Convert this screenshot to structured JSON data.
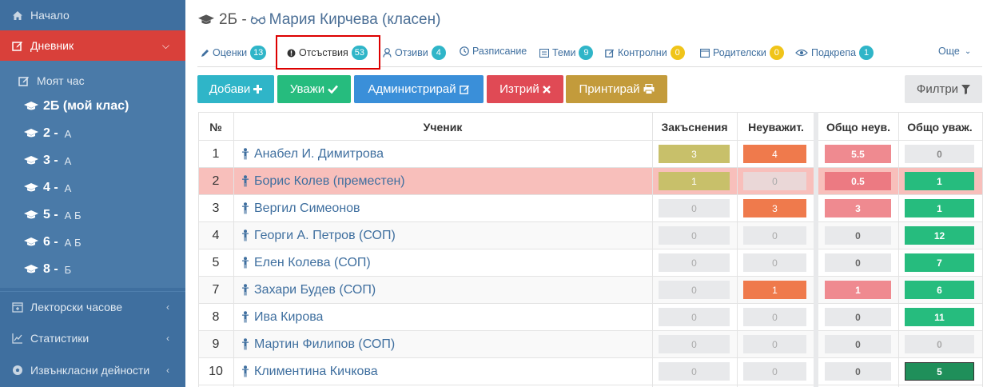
{
  "sidebar": {
    "items": [
      {
        "label": "Начало",
        "icon": "home-icon"
      },
      {
        "label": "Дневник",
        "icon": "edit-icon"
      },
      {
        "label": "Моят час",
        "icon": "edit-icon"
      },
      {
        "label": "2Б (мой клас)",
        "icon": "graduation-cap-icon"
      },
      {
        "label": "2 -",
        "suffix": "А",
        "icon": "graduation-cap-icon"
      },
      {
        "label": "3 -",
        "suffix": "А",
        "icon": "graduation-cap-icon"
      },
      {
        "label": "4 -",
        "suffix": "А",
        "icon": "graduation-cap-icon"
      },
      {
        "label": "5 -",
        "suffix": "А Б",
        "icon": "graduation-cap-icon"
      },
      {
        "label": "6 -",
        "suffix": "А Б",
        "icon": "graduation-cap-icon"
      },
      {
        "label": "8 -",
        "suffix": "Б",
        "icon": "graduation-cap-icon"
      },
      {
        "label": "Лекторски часове",
        "icon": "calendar-plus-icon"
      },
      {
        "label": "Статистики",
        "icon": "line-chart-icon"
      },
      {
        "label": "Извънкласни дейности",
        "icon": "soccer-ball-icon"
      }
    ]
  },
  "header": {
    "class_name": "2Б -",
    "teacher": "Мария Кирчева (класен)"
  },
  "tabs": [
    {
      "label": "Оценки",
      "badge": "13",
      "icon": "pencil-icon"
    },
    {
      "label": "Отсъствия",
      "badge": "53",
      "icon": "alert-circle-icon"
    },
    {
      "label": "Отзиви",
      "badge": "4",
      "icon": "user-icon"
    },
    {
      "label": "Разписание",
      "badge": "",
      "icon": "clock-icon"
    },
    {
      "label": "Теми",
      "badge": "9",
      "icon": "list-icon"
    },
    {
      "label": "Контролни",
      "badge": "0",
      "icon": "edit-icon"
    },
    {
      "label": "Родителски",
      "badge": "0",
      "icon": "calendar-icon"
    },
    {
      "label": "Подкрепа",
      "badge": "1",
      "icon": "eye-icon"
    }
  ],
  "more_label": "Още",
  "toolbar": {
    "add": "Добави",
    "excuse": "Уважи",
    "administer": "Администрирай",
    "delete": "Изтрий",
    "print": "Принтирай",
    "filters": "Филтри"
  },
  "colors": {
    "teal": "#2fb5c8",
    "green": "#26bc7e",
    "blue": "#3a8fd9",
    "red": "#e04a55",
    "olive": "#c39b3b",
    "orange": "#ef7a4c",
    "pink": "#ef8a90",
    "khaki": "#c8c06a"
  },
  "table": {
    "headers": [
      "№",
      "Ученик",
      "Закъснения",
      "Неуважит.",
      "Общо неув.",
      "Общо уваж."
    ],
    "rows": [
      {
        "no": "1",
        "name": "Анабел И. Димитрова",
        "late": "3",
        "unexc": "4",
        "total_unexc": "5.5",
        "total_exc": "0"
      },
      {
        "no": "2",
        "name": "Борис Колев (преместен)",
        "late": "1",
        "unexc": "0",
        "total_unexc": "0.5",
        "total_exc": "1"
      },
      {
        "no": "3",
        "name": "Вергил Симеонов",
        "late": "0",
        "unexc": "3",
        "total_unexc": "3",
        "total_exc": "1"
      },
      {
        "no": "4",
        "name": "Георги А. Петров (СОП)",
        "late": "0",
        "unexc": "0",
        "total_unexc": "0",
        "total_exc": "12"
      },
      {
        "no": "5",
        "name": "Елен Колева (СОП)",
        "late": "0",
        "unexc": "0",
        "total_unexc": "0",
        "total_exc": "7"
      },
      {
        "no": "7",
        "name": "Захари Будев (СОП)",
        "late": "0",
        "unexc": "1",
        "total_unexc": "1",
        "total_exc": "6"
      },
      {
        "no": "8",
        "name": "Ива Кирова",
        "late": "0",
        "unexc": "0",
        "total_unexc": "0",
        "total_exc": "11"
      },
      {
        "no": "9",
        "name": "Мартин Филипов (СОП)",
        "late": "0",
        "unexc": "0",
        "total_unexc": "0",
        "total_exc": "0"
      },
      {
        "no": "10",
        "name": "Климентина Кичкова",
        "late": "0",
        "unexc": "0",
        "total_unexc": "0",
        "total_exc": "5"
      }
    ]
  }
}
